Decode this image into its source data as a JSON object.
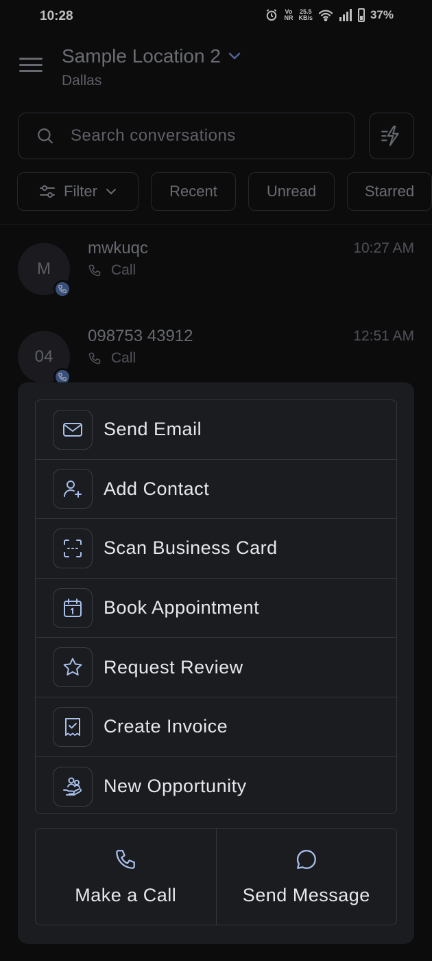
{
  "status_bar": {
    "time": "10:28",
    "network_top": "Vo",
    "network_bottom": "NR",
    "speed_top": "25.5",
    "speed_bottom": "KB/s",
    "battery": "37%"
  },
  "header": {
    "location_title": "Sample Location 2",
    "location_subtitle": "Dallas"
  },
  "search": {
    "placeholder": "Search conversations"
  },
  "filters": {
    "filter_label": "Filter",
    "chips": [
      "Recent",
      "Unread",
      "Starred"
    ]
  },
  "conversations": [
    {
      "avatar": "M",
      "name": "mwkuqc",
      "type": "Call",
      "time": "10:27 AM"
    },
    {
      "avatar": "04",
      "name": "098753 43912",
      "type": "Call",
      "time": "12:51 AM"
    }
  ],
  "quick_actions": {
    "items": [
      {
        "label": "Send Email",
        "icon": "mail-icon"
      },
      {
        "label": "Add Contact",
        "icon": "user-plus-icon"
      },
      {
        "label": "Scan Business Card",
        "icon": "scan-icon"
      },
      {
        "label": "Book Appointment",
        "icon": "calendar-icon"
      },
      {
        "label": "Request Review",
        "icon": "star-icon"
      },
      {
        "label": "Create Invoice",
        "icon": "receipt-icon"
      },
      {
        "label": "New Opportunity",
        "icon": "hand-users-icon"
      }
    ],
    "make_call_label": "Make a Call",
    "send_message_label": "Send Message"
  },
  "colors": {
    "background": "#101012",
    "sheet": "#1b1c20",
    "accent_icon": "#a9c0ec",
    "border": "#34363d"
  }
}
